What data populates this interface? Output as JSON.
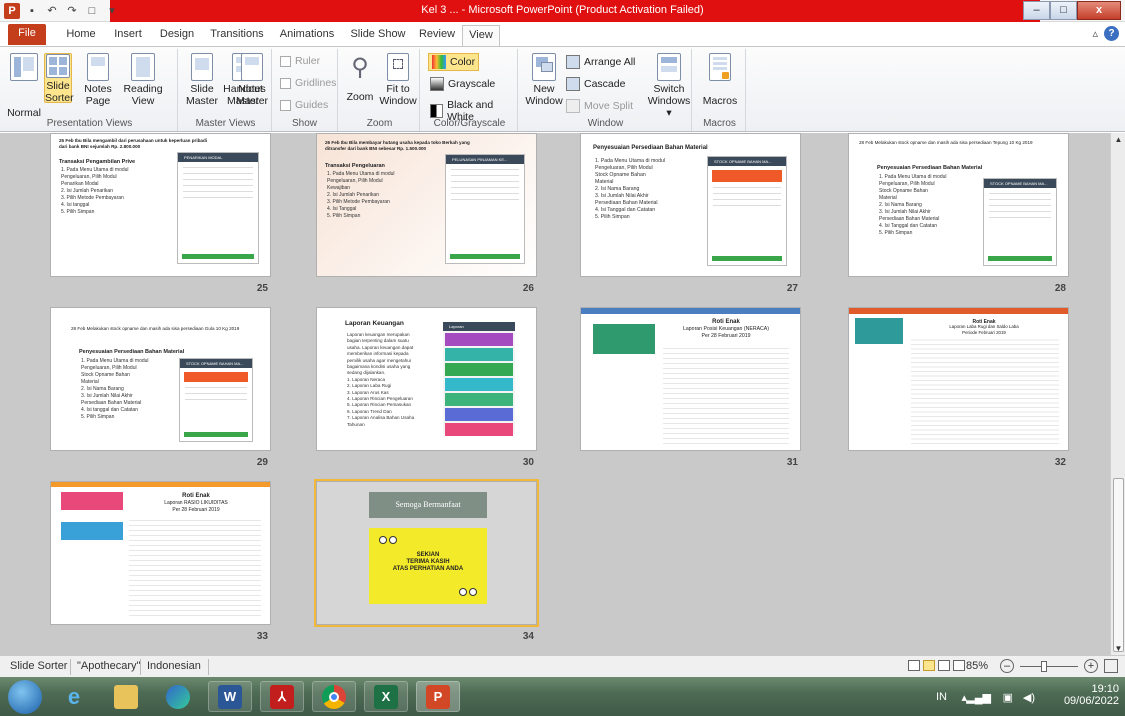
{
  "window": {
    "title": "Kel 3 ... - Microsoft PowerPoint (Product Activation Failed)"
  },
  "qat": {
    "app_icon": "P",
    "undo": "↶",
    "redo": "↷",
    "new": "□",
    "more": "▾"
  },
  "window_buttons": {
    "minimize": "–",
    "maximize": "□",
    "close": "x"
  },
  "ribbon_tabs": [
    "File",
    "Home",
    "Insert",
    "Design",
    "Transitions",
    "Animations",
    "Slide Show",
    "Review",
    "View"
  ],
  "ribbon": {
    "presentation_views": {
      "label": "Presentation Views",
      "buttons": [
        {
          "label": "Normal"
        },
        {
          "label": "Slide\nSorter"
        },
        {
          "label": "Notes\nPage"
        },
        {
          "label": "Reading\nView"
        }
      ]
    },
    "master_views": {
      "label": "Master Views",
      "buttons": [
        {
          "label": "Slide\nMaster"
        },
        {
          "label": "Handout\nMaster"
        },
        {
          "label": "Notes\nMaster"
        }
      ]
    },
    "show": {
      "label": "Show",
      "items": [
        "Ruler",
        "Gridlines",
        "Guides"
      ]
    },
    "zoom": {
      "label": "Zoom",
      "buttons": [
        {
          "label": "Zoom"
        },
        {
          "label": "Fit to\nWindow"
        }
      ]
    },
    "color_grayscale": {
      "label": "Color/Grayscale",
      "items": [
        "Color",
        "Grayscale",
        "Black and White"
      ]
    },
    "window": {
      "label": "Window",
      "new_window": "New\nWindow",
      "items": [
        "Arrange All",
        "Cascade",
        "Move Split"
      ],
      "switch_windows": "Switch\nWindows ▾"
    },
    "macros": {
      "label": "Macros",
      "button": "Macros"
    }
  },
  "slides": [
    {
      "number": "25",
      "title": "25 Feb  Ibu Bila mengambil dari perusahaan untuk keperluan pribadi dari bank BNI sejumlah Rp. 2.800.000",
      "heading": "Transaksi Pengambilan Prive",
      "lines": "1. Pada Menu Utama di modul\n   Pengeluaran, Pilih Modul\n   Penarikan Modal\n2. Isi Jumlah Penarikan\n3. Pilih Metode Pembayaran\n4. Isi tanggal\n5. Pilih Simpan",
      "phone_title": "PENARIKAN MODAL"
    },
    {
      "number": "26",
      "title": "26 Feb  Ibu Bila membayar hutang usaha kepada toko Berkah yang ditransfer dari bank BNI sebesar Rp. 1.500.000",
      "heading": "Transaksi Pengeluaran",
      "lines": "1. Pada Menu Utama di modul\n   Pengeluaran, Pilih Modul\n   Kewajiban\n2. Isi Jumlah Penarikan\n3. Pilih Metode Pembayaran\n4. Isi Tanggal\n5. Pilih Simpan",
      "phone_title": "PELUNASAN PINJAMAN KE..."
    },
    {
      "number": "27",
      "title": "Penyesuaian Persediaan Bahan Material",
      "heading": "",
      "lines": "1. Pada Menu Utama di modul\n   Pengeluaran, Pilih Modul\n   Stock Opname Bahan\n   Material\n2. Isi Nama Barang\n3. Isi Jumlah Nilai Akhir\n   Persediaan Bahan Material\n4. Isi Tanggal dan Catatan\n5. Pilih Simpan",
      "phone_title": "STOCK OPNAME BAHAN MA..."
    },
    {
      "number": "28",
      "title": "28 Feb  Melakukan stock opname dan masih ada sisa persediaan Tepung 10 Kg 2019",
      "heading": "Penyesuaian Persediaan Bahan Material",
      "lines": "1. Pada Menu Utama di modul\n   Pengeluaran, Pilih Modul\n   Stock Opname Bahan\n   Material\n2. Isi Nama Barang\n3. Isi Jumlah Nilai Akhir\n   Persediaan Bahan Material\n4. Isi Tanggal dan Catatan\n5. Pilih Simpan",
      "phone_title": "STOCK OPNAME BAHAN MA..."
    },
    {
      "number": "29",
      "title": "28 Feb  Melakukan stock opname dan masih ada sisa persediaan Gula 10 Kg 2019",
      "heading": "Penyesuaian Persediaan Bahan Material",
      "lines": "1. Pada Menu Utama di modul\n   Pengeluaran, Pilih Modul\n   Stock Opname Bahan\n   Material\n2. Isi Nama Barang\n3. Isi Jumlah Nilai Akhir\n   Persediaan Bahan Material\n4. Isi tanggal dan Catatan\n5. Pilih Simpan",
      "phone_title": "STOCK OPNAME BAHAN MA..."
    },
    {
      "number": "30",
      "title": "Laporan Keuangan",
      "heading": "",
      "lines": "Laporan keuangan merupakan\nbagian terpenting dalam suatu\nusaha. Laporan keuangan dapat\nmemberikan informasi kepada\npemilik usaha agar mengetahui\nbagaimana kondisi usaha yang\nsedang dijalankan.\n1. Laporan Neraca\n2. Laporan Laba Rugi\n3. Laporan Arus Kas\n4. Laporan Rincian Pengeluaran\n5. Laporan Rincian Pemasukan\n6. Laporan Trend Dan\n7. Laporan Analisa Bahan Usaha\n   Tahunan",
      "phone_title": "Laporan"
    },
    {
      "number": "31",
      "title": "Roti Enak",
      "heading": "Laporan Posisi Keuangan (NERACA)\nPer 28 Februari 2019",
      "lines": "",
      "phone_title": ""
    },
    {
      "number": "32",
      "title": "Roti Enak",
      "heading": "Laporan Laba Rugi dan Saldo Laba\nPeriode Februari 2019",
      "lines": "",
      "phone_title": ""
    },
    {
      "number": "33",
      "title": "Roti Enak",
      "heading": "Laporan RASIO LIKUIDITAS\nPer 28 Februari 2019",
      "lines": "",
      "phone_title": ""
    },
    {
      "number": "34",
      "title": "Semoga Bermanfaat",
      "heading": "SEKIAN\nTERIMA KASIH\nATAS PERHATIAN ANDA",
      "lines": "",
      "phone_title": ""
    }
  ],
  "status": {
    "view": "Slide Sorter",
    "theme": "\"Apothecary\"",
    "language": "Indonesian",
    "zoom": "85%",
    "zoom_level_pct": 85
  },
  "taskbar": {
    "apps": [
      "start-orb",
      "internet-explorer",
      "file-explorer",
      "edge",
      "word",
      "acrobat",
      "chrome",
      "excel",
      "powerpoint"
    ],
    "lang": "IN",
    "time": "19:10",
    "date": "09/06/2022"
  }
}
